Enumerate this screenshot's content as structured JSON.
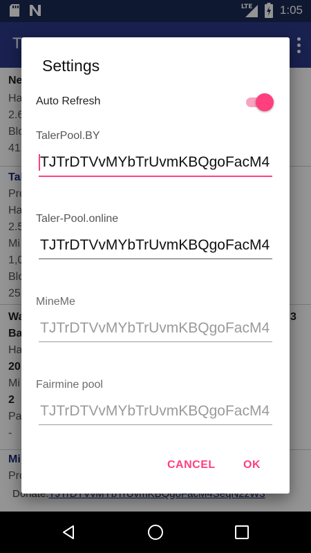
{
  "status_bar": {
    "time": "1:05",
    "network": "LTE",
    "icons": [
      "sd-card-icon",
      "n-notification-icon",
      "signal-icon",
      "battery-charging-icon"
    ]
  },
  "app_bar": {
    "title": "T",
    "menu_icon": "more-vert-icon"
  },
  "background": {
    "cards": [
      {
        "lines": [
          "Ne",
          "Ha",
          "2.6",
          "Blo",
          "41"
        ]
      },
      {
        "lines": [
          "Tal",
          "Pro",
          "Ha",
          "2.5",
          "Mi",
          "1,0",
          "Blo",
          "25"
        ]
      },
      {
        "lines": [
          "Wa",
          "Ba",
          "Ha",
          "20",
          "Mi",
          "2",
          "Pa",
          "-"
        ],
        "right_fragment": "3"
      },
      {
        "lines": [
          "Mi",
          "Pro"
        ]
      }
    ],
    "donate_label": "Donate:",
    "donate_address": "TJTrDTVvMYbTrUvmKBQgoFacM4SeqN2zW3"
  },
  "dialog": {
    "title": "Settings",
    "auto_refresh": {
      "label": "Auto Refresh",
      "enabled": true
    },
    "pools": [
      {
        "name": "TalerPool.BY",
        "value": "TJTrDTVvMYbTrUvmKBQgoFacM4",
        "state": "focused"
      },
      {
        "name": "Taler-Pool.online",
        "value": "TJTrDTVvMYbTrUvmKBQgoFacM4",
        "state": "enabled"
      },
      {
        "name": "MineMe",
        "value": "TJTrDTVvMYbTrUvmKBQgoFacM4",
        "state": "disabled"
      },
      {
        "name": "Fairmine pool",
        "value": "TJTrDTVvMYbTrUvmKBQgoFacM4",
        "state": "disabled"
      }
    ],
    "cancel_label": "CANCEL",
    "ok_label": "OK"
  },
  "colors": {
    "accent": "#ff3f7e",
    "primary": "#2b3a8a",
    "primary_dark": "#1b2a55"
  }
}
